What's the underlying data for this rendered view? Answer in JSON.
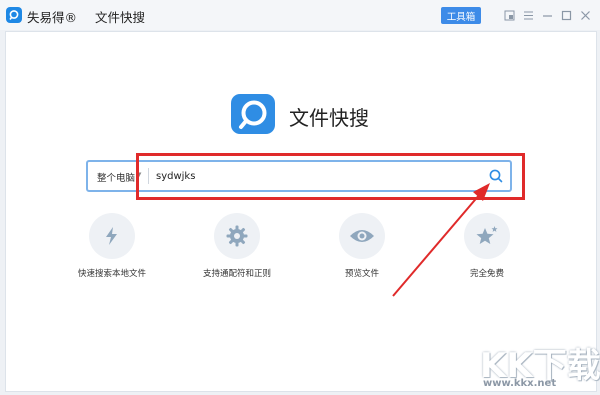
{
  "titlebar": {
    "brand": "失易得®",
    "title": "文件快搜",
    "toolbox_label": "工具箱",
    "controls": [
      "window-icon",
      "menu-icon",
      "minimize-icon",
      "maximize-icon",
      "close-icon"
    ]
  },
  "hero": {
    "title": "文件快搜",
    "logo_icon": "search-icon"
  },
  "search": {
    "scope": "整个电脑",
    "value": "sydwjks",
    "button_icon": "search-icon"
  },
  "features": [
    {
      "icon": "lightning-icon",
      "label": "快速搜索本地文件"
    },
    {
      "icon": "gear-icon",
      "label": "支持通配符和正则"
    },
    {
      "icon": "eye-icon",
      "label": "预览文件"
    },
    {
      "icon": "star-icon",
      "label": "完全免费"
    }
  ],
  "watermark": {
    "logo": "KK下载",
    "url": "www.kkx.net"
  },
  "colors": {
    "accent": "#2f8de4",
    "annotation": "#e02a2a",
    "icon_gray": "#8fa7bd"
  }
}
